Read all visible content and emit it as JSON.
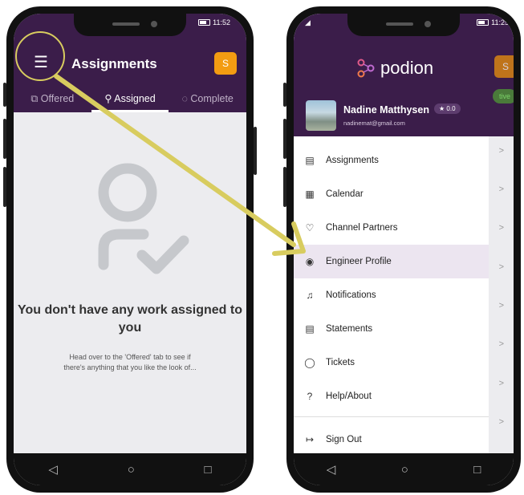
{
  "left_phone": {
    "status_time": "11:52",
    "title": "Assignments",
    "avatar_initial": "S",
    "tabs": [
      {
        "icon": "offered-icon",
        "label": "Offered"
      },
      {
        "icon": "person-check-icon",
        "label": "Assigned"
      },
      {
        "icon": "check-circle-icon",
        "label": "Complete"
      }
    ],
    "empty_title": "You don't have any work assigned to you",
    "empty_sub": "Head over to the 'Offered' tab to see if there's anything that you like the look of..."
  },
  "right_phone": {
    "status_time": "11:25",
    "brand": "podion",
    "avatar_initial": "S",
    "profile_name": "Nadine Matthysen",
    "profile_email": "nadinemat@gmail.com",
    "rating": "★ 0.0",
    "bg_tab_partial": "tive",
    "menu": [
      {
        "label": "Assignments",
        "icon": "document-icon"
      },
      {
        "label": "Calendar",
        "icon": "calendar-icon"
      },
      {
        "label": "Channel Partners",
        "icon": "handshake-icon"
      },
      {
        "label": "Engineer Profile",
        "icon": "profile-icon",
        "selected": true
      },
      {
        "label": "Notifications",
        "icon": "bell-icon"
      },
      {
        "label": "Statements",
        "icon": "statement-icon"
      },
      {
        "label": "Tickets",
        "icon": "chat-icon"
      },
      {
        "label": "Help/About",
        "icon": "help-icon"
      },
      {
        "label": "Sign Out",
        "icon": "sign-out-icon"
      }
    ]
  },
  "nav_buttons": [
    "◁",
    "○",
    "□"
  ],
  "colors": {
    "primary": "#3b1d4a",
    "accent": "#f39c12",
    "arrow": "#d8cc5f"
  }
}
